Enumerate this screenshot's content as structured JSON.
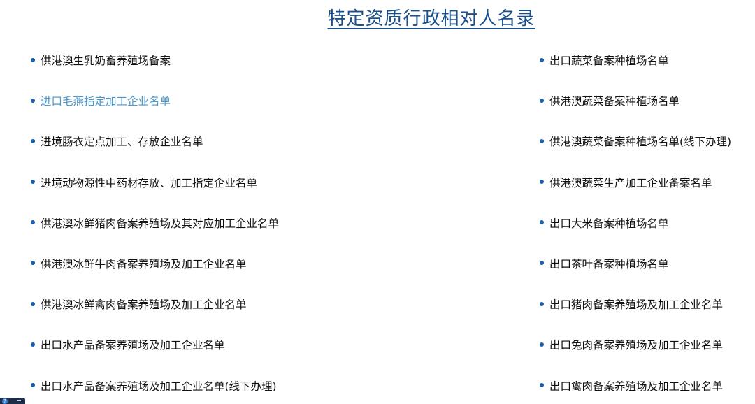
{
  "title": "特定资质行政相对人名录",
  "left_items": [
    "供港澳生乳奶畜养殖场备案",
    "进口毛燕指定加工企业名单",
    "进境肠衣定点加工、存放企业名单",
    "进境动物源性中药材存放、加工指定企业名单",
    "供港澳冰鲜猪肉备案养殖场及其对应加工企业名单",
    "供港澳冰鲜牛肉备案养殖场及加工企业名单",
    "供港澳冰鲜禽肉备案养殖场及加工企业名单",
    "出口水产品备案养殖场及加工企业名单",
    "出口水产品备案养殖场及加工企业名单(线下办理)"
  ],
  "right_items": [
    "出口蔬菜备案种植场名单",
    "供港澳蔬菜备案种植场名单",
    "供港澳蔬菜备案种植场名单(线下办理)",
    "供港澳蔬菜生产加工企业备案名单",
    "出口大米备案种植场名单",
    "出口茶叶备案种植场名单",
    "出口猪肉备案养殖场及加工企业名单",
    "出口兔肉备案养殖场及加工企业名单",
    "出口禽肉备案养殖场及加工企业名单"
  ],
  "colors": {
    "title": "#1a4f8a",
    "text": "#111111",
    "active_link": "#4a97cc",
    "bullet": "#1a5da8"
  },
  "help_widget": {
    "icon": "help-icon",
    "glyph": "?"
  }
}
